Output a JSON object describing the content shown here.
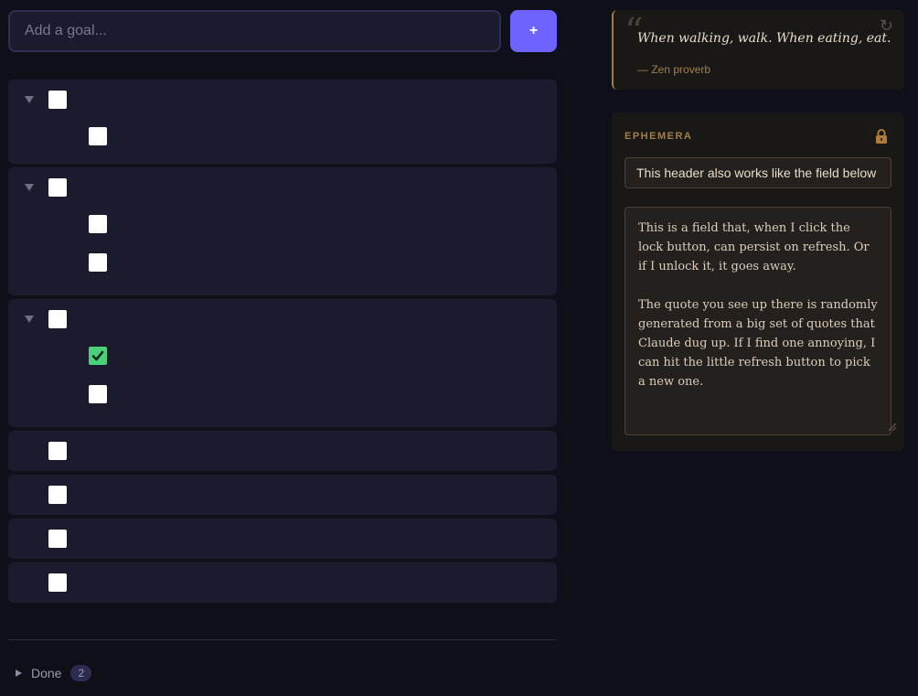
{
  "add_goal": {
    "placeholder": "Add a goal...",
    "button_label": "+"
  },
  "goals": {
    "cards": [
      {
        "type": "group",
        "expanded": true,
        "parent_checked": false,
        "children": [
          {
            "checked": false
          }
        ]
      },
      {
        "type": "group",
        "expanded": true,
        "parent_checked": false,
        "children": [
          {
            "checked": false
          },
          {
            "checked": false
          }
        ]
      },
      {
        "type": "group",
        "expanded": true,
        "parent_checked": false,
        "children": [
          {
            "checked": true
          },
          {
            "checked": false
          }
        ]
      },
      {
        "type": "single",
        "checked": false
      },
      {
        "type": "single",
        "checked": false
      },
      {
        "type": "single",
        "checked": false
      },
      {
        "type": "single",
        "checked": false
      }
    ]
  },
  "done": {
    "label": "Done",
    "count": "2"
  },
  "quote": {
    "mark": "“",
    "text": "When walking, walk. When eating, eat.",
    "author": "— Zen proverb",
    "refresh_icon": "↻"
  },
  "ephemera": {
    "title": "EPHEMERA",
    "header_value": "This header also works like the field below",
    "body_value": "This is a field that, when I click the lock button, can persist on refresh. Or if I unlock it, it goes away.\n\nThe quote you see up there is randomly generated from a big set of quotes that Claude dug up. If I find one annoying, I can hit the little refresh button to pick a new one."
  },
  "colors": {
    "accent": "#6e63ff",
    "checked": "#4ad07a",
    "gold": "#a0804a"
  }
}
